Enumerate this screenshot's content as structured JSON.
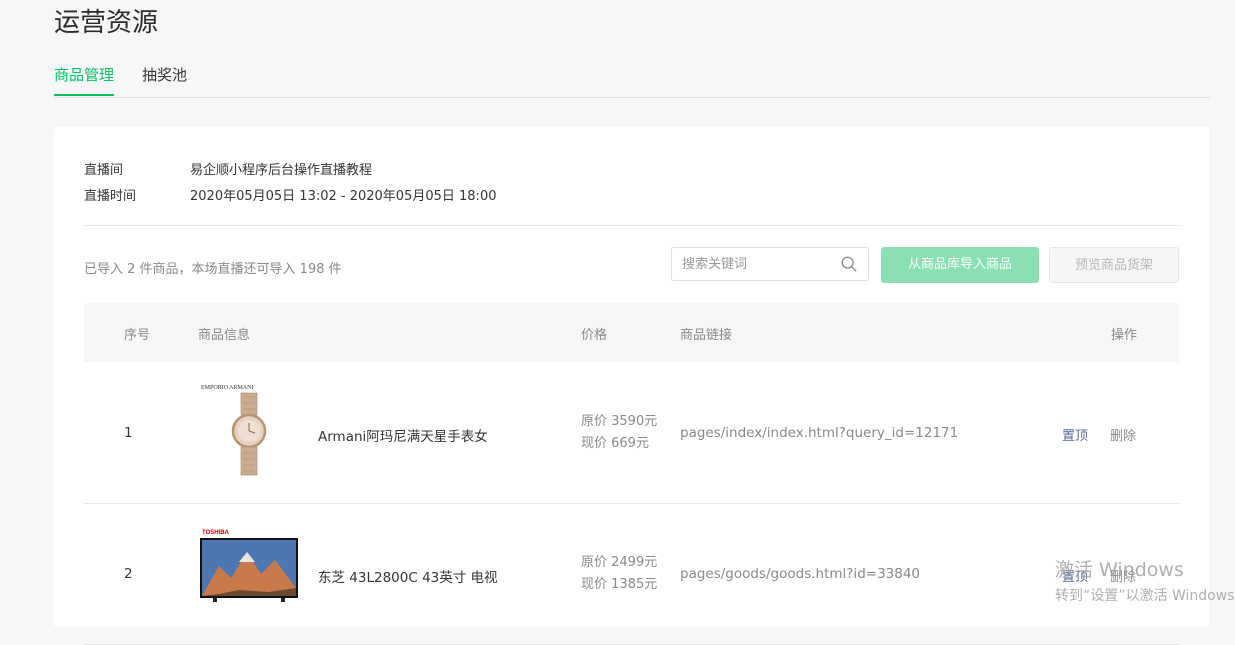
{
  "page": {
    "title": "运营资源"
  },
  "tabs": [
    {
      "label": "商品管理",
      "active": true
    },
    {
      "label": "抽奖池",
      "active": false
    }
  ],
  "live": {
    "room_label": "直播间",
    "room_value": "易企顺小程序后台操作直播教程",
    "time_label": "直播时间",
    "time_value": "2020年05月05日 13:02 - 2020年05月05日 18:00"
  },
  "toolbar": {
    "import_status": "已导入 2 件商品，本场直播还可导入 198 件",
    "search_placeholder": "搜索关键词",
    "import_button": "从商品库导入商品",
    "preview_button": "预览商品货架"
  },
  "table": {
    "headers": [
      "序号",
      "商品信息",
      "价格",
      "商品链接",
      "操作"
    ],
    "rows": [
      {
        "index": "1",
        "image": "watch-image",
        "name": "Armani阿玛尼满天星手表女",
        "original_price": "原价 3590元",
        "current_price": "现价 669元",
        "link": "pages/index/index.html?query_id=12171",
        "pin": "置顶",
        "delete": "删除"
      },
      {
        "index": "2",
        "image": "tv-image",
        "name": "东芝 43L2800C 43英寸 电视",
        "original_price": "原价 2499元",
        "current_price": "现价 1385元",
        "link": "pages/goods/goods.html?id=33840",
        "pin": "置顶",
        "delete": "删除"
      }
    ]
  },
  "brand_marks": {
    "watch": "EMPORIO ARMANI",
    "tv": "TOSHIBA"
  },
  "watermark": {
    "line1": "激活 Windows",
    "line2": "转到“设置”以激活 Windows。"
  },
  "colors": {
    "accent": "#07c160",
    "link": "#576b95",
    "disabled_button": "#8be0b3"
  }
}
